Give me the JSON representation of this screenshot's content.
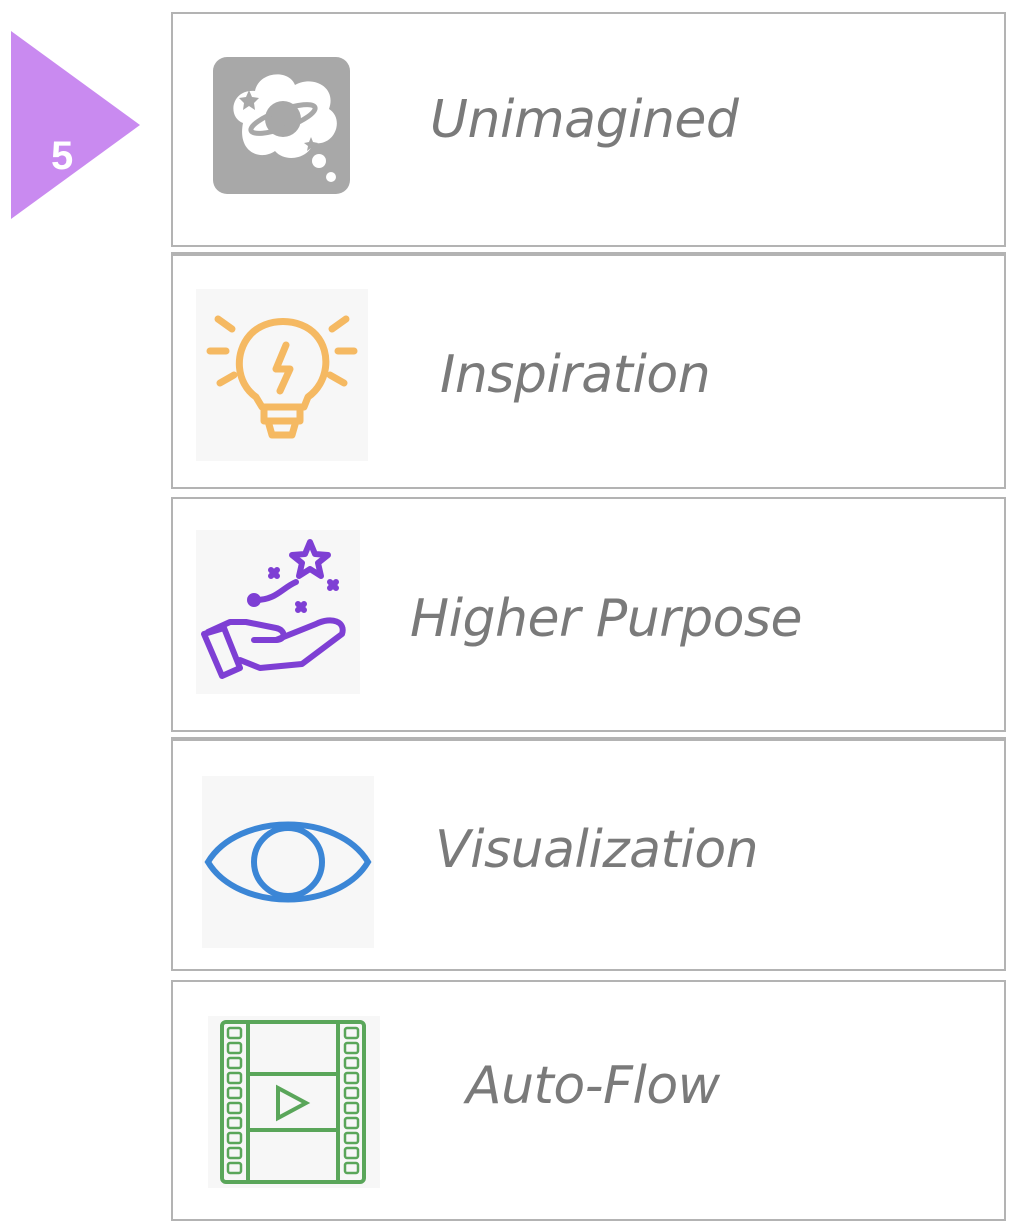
{
  "step": {
    "number": "5",
    "color": "#c98af0"
  },
  "items": [
    {
      "label": "Unimagined",
      "icon": "planet-in-cloud-icon",
      "color": "#a3a3a3"
    },
    {
      "label": "Inspiration",
      "icon": "lightbulb-icon",
      "color": "#f5b962"
    },
    {
      "label": "Higher Purpose",
      "icon": "hand-with-star-icon",
      "color": "#7e3fd4"
    },
    {
      "label": "Visualization",
      "icon": "eye-icon",
      "color": "#3b86d6"
    },
    {
      "label": "Auto-Flow",
      "icon": "film-play-icon",
      "color": "#5aa65a"
    }
  ]
}
